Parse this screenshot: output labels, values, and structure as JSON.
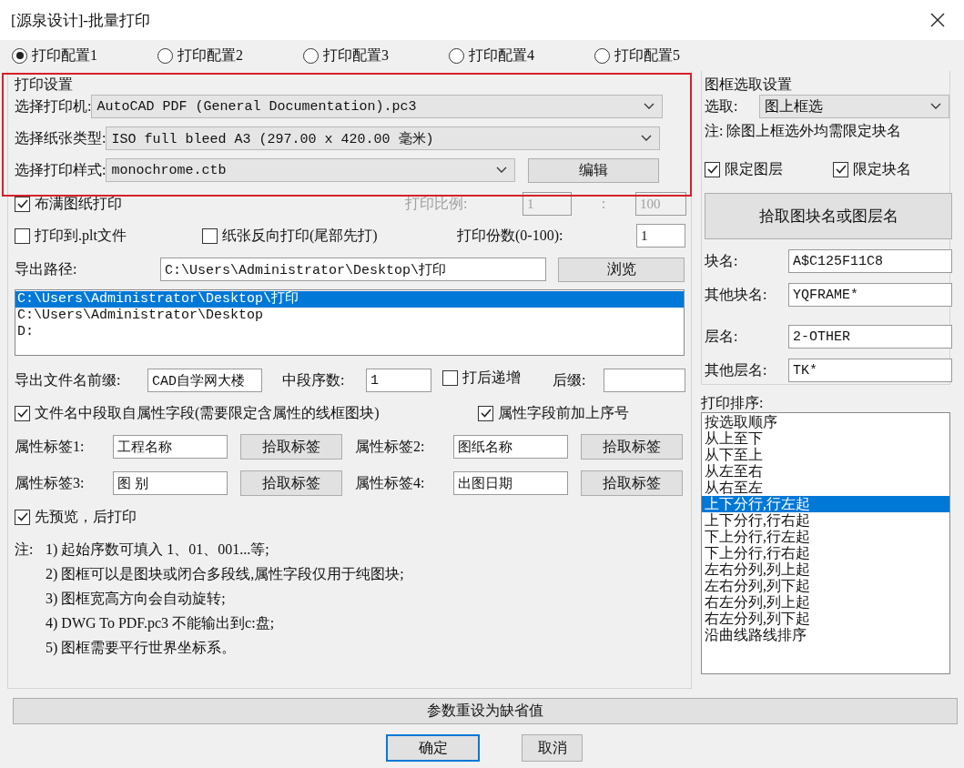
{
  "window": {
    "title": "[源泉设计]-批量打印"
  },
  "profiles": [
    {
      "label": "打印配置1",
      "selected": true
    },
    {
      "label": "打印配置2",
      "selected": false
    },
    {
      "label": "打印配置3",
      "selected": false
    },
    {
      "label": "打印配置4",
      "selected": false
    },
    {
      "label": "打印配置5",
      "selected": false
    }
  ],
  "print_settings": {
    "title": "打印设置",
    "printer": {
      "label": "选择打印机:",
      "value": "AutoCAD PDF (General Documentation).pc3"
    },
    "paper": {
      "label": "选择纸张类型:",
      "value": "ISO full bleed A3 (297.00 x 420.00 毫米)"
    },
    "style": {
      "label": "选择打印样式:",
      "value": "monochrome.ctb"
    },
    "edit_button": "编辑"
  },
  "fit_to_paper": {
    "label": "布满图纸打印",
    "checked": true
  },
  "scale": {
    "label": "打印比例:",
    "value_1": "1",
    "separator": ":",
    "value_2": "100",
    "disabled": true
  },
  "plot_to_file": {
    "label": "打印到.plt文件",
    "checked": false
  },
  "reverse_order": {
    "label": "纸张反向打印(尾部先打)",
    "checked": false
  },
  "copies": {
    "label": "打印份数(0-100):",
    "value": "1"
  },
  "export_path": {
    "label": "导出路径:",
    "value": "C:\\Users\\Administrator\\Desktop\\打印",
    "browse_button": "浏览"
  },
  "path_list": [
    {
      "text": "C:\\Users\\Administrator\\Desktop\\打印",
      "selected": true
    },
    {
      "text": "C:\\Users\\Administrator\\Desktop",
      "selected": false
    },
    {
      "text": "D:",
      "selected": false
    }
  ],
  "prefix": {
    "label": "导出文件名前缀:",
    "value": "CAD自学网大楼"
  },
  "middle_number": {
    "label": "中段序数:",
    "value": "1"
  },
  "increment": {
    "label": "打后递增",
    "checked": false
  },
  "suffix": {
    "label": "后缀:"
  },
  "middle_from_attribute": {
    "label": "文件名中段取自属性字段(需要限定含属性的线框图块)",
    "checked": true
  },
  "prefix_serial": {
    "label": "属性字段前加上序号",
    "checked": true
  },
  "attribute_tags": [
    {
      "label": "属性标签1:",
      "value": "工程名称",
      "button": "拾取标签"
    },
    {
      "label": "属性标签2:",
      "value": "图纸名称",
      "button": "拾取标签"
    },
    {
      "label": "属性标签3:",
      "value": "图 别",
      "button": "拾取标签"
    },
    {
      "label": "属性标签4:",
      "value": "出图日期",
      "button": "拾取标签"
    }
  ],
  "preview_first": {
    "label": "先预览，后打印",
    "checked": true
  },
  "notes": {
    "label": "注:",
    "items": [
      "1) 起始序数可填入 1、01、001...等;",
      "2) 图框可以是图块或闭合多段线,属性字段仅用于纯图块;",
      "3) 图框宽高方向会自动旋转;",
      "4) DWG To PDF.pc3 不能输出到c:盘;",
      "5) 图框需要平行世界坐标系。"
    ]
  },
  "frame_selection": {
    "title": "图框选取设置",
    "select_label": "选取:",
    "select_value": "图上框选",
    "note": "注: 除图上框选外均需限定块名",
    "limit_layer": {
      "label": "限定图层",
      "checked": true
    },
    "limit_block": {
      "label": "限定块名",
      "checked": true
    },
    "pick_button": "拾取图块名或图层名",
    "fields": [
      {
        "label": "块名:",
        "value": "A$C125F11C8"
      },
      {
        "label": "其他块名:",
        "value": "YQFRAME*"
      },
      {
        "label": "层名:",
        "value": "2-OTHER"
      },
      {
        "label": "其他层名:",
        "value": "TK*"
      }
    ]
  },
  "sort": {
    "label": "打印排序:",
    "items": [
      {
        "text": "按选取顺序",
        "selected": false
      },
      {
        "text": "从上至下",
        "selected": false
      },
      {
        "text": "从下至上",
        "selected": false
      },
      {
        "text": "从左至右",
        "selected": false
      },
      {
        "text": "从右至左",
        "selected": false
      },
      {
        "text": "上下分行,行左起",
        "selected": true
      },
      {
        "text": "上下分行,行右起",
        "selected": false
      },
      {
        "text": "下上分行,行左起",
        "selected": false
      },
      {
        "text": "下上分行,行右起",
        "selected": false
      },
      {
        "text": "左右分列,列上起",
        "selected": false
      },
      {
        "text": "左右分列,列下起",
        "selected": false
      },
      {
        "text": "右左分列,列上起",
        "selected": false
      },
      {
        "text": "右左分列,列下起",
        "selected": false
      },
      {
        "text": "沿曲线路线排序",
        "selected": false
      }
    ]
  },
  "reset_button": "参数重设为缺省值",
  "ok_button": "确定",
  "cancel_button": "取消"
}
